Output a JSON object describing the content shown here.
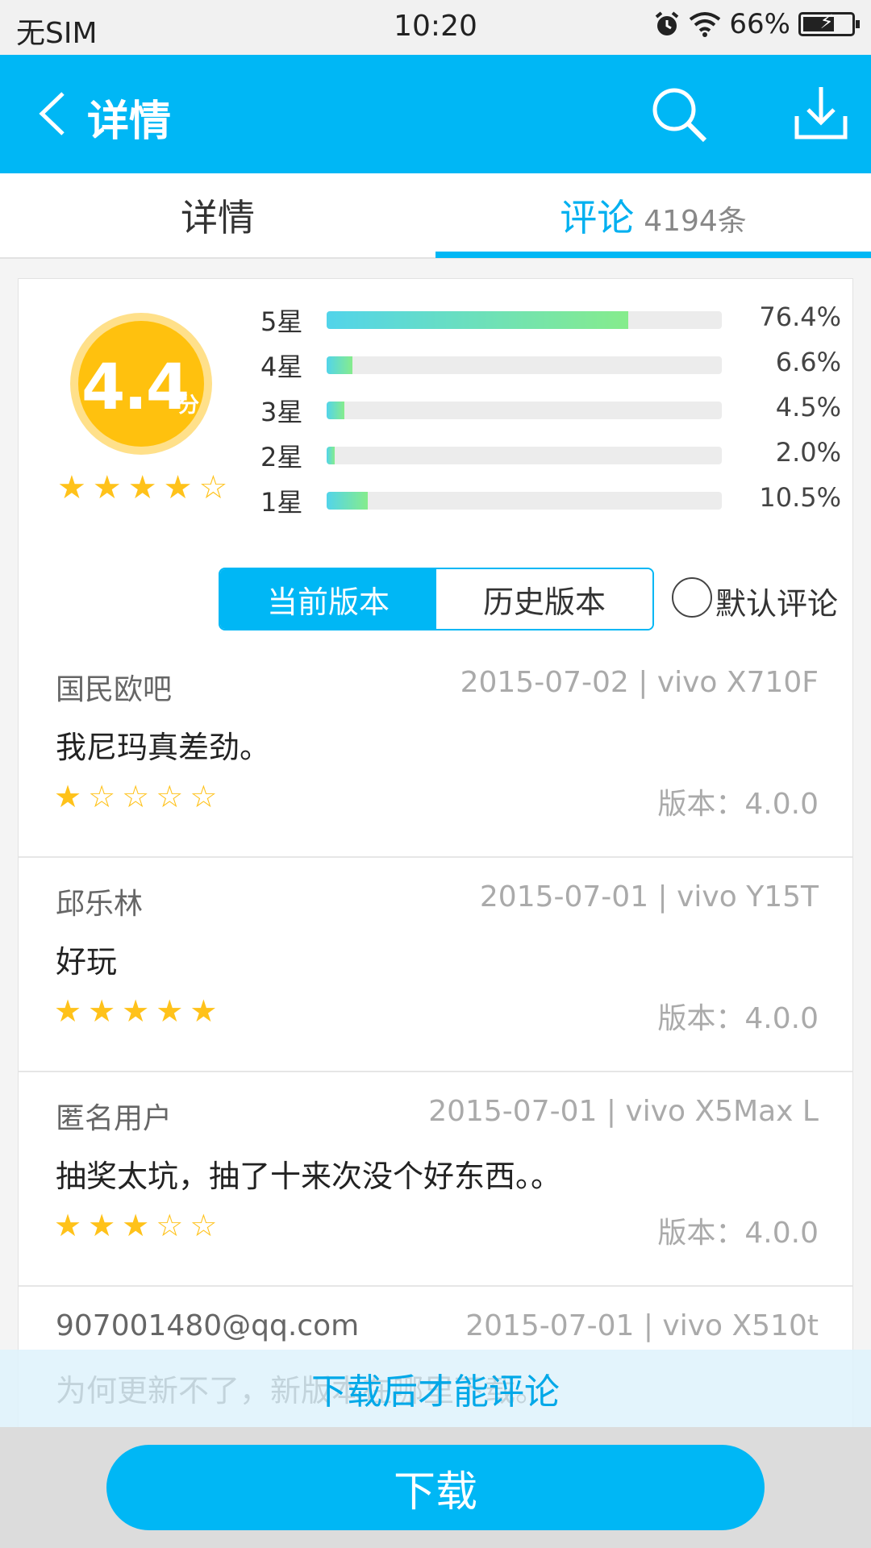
{
  "status_bar": {
    "carrier": "无SIM",
    "time": "10:20",
    "battery": "66%",
    "battery_level": 0.66
  },
  "header": {
    "title": "详情"
  },
  "tabs": {
    "details": "详情",
    "comments": "评论",
    "comments_count": "4194条"
  },
  "rating": {
    "score": "4.4",
    "unit": "分",
    "stars": 4,
    "distribution": [
      {
        "label": "5星",
        "percent": "76.4%",
        "value": 76.4
      },
      {
        "label": "4星",
        "percent": "6.6%",
        "value": 6.6
      },
      {
        "label": "3星",
        "percent": "4.5%",
        "value": 4.5
      },
      {
        "label": "2星",
        "percent": "2.0%",
        "value": 2.0
      },
      {
        "label": "1星",
        "percent": "10.5%",
        "value": 10.5
      }
    ]
  },
  "filters": {
    "current_version": "当前版本",
    "history_version": "历史版本",
    "default_sort": "默认评论"
  },
  "reviews": [
    {
      "user": "国民欧吧",
      "meta": "2015-07-02 | vivo X710F",
      "text": "我尼玛真差劲。",
      "stars": 1,
      "version": "版本：4.0.0"
    },
    {
      "user": "邱乐林",
      "meta": "2015-07-01 | vivo Y15T",
      "text": "好玩",
      "stars": 5,
      "version": "版本：4.0.0"
    },
    {
      "user": "匿名用户",
      "meta": "2015-07-01 | vivo X5Max L",
      "text": "抽奖太坑，抽了十来次没个好东西。。",
      "stars": 3,
      "version": "版本：4.0.0"
    },
    {
      "user": "907001480@qq.com",
      "meta": "2015-07-01 | vivo X510t",
      "text": "为何更新不了，新版本在哪里下载。",
      "stars": 0,
      "version": ""
    }
  ],
  "overlay": {
    "hint": "下载后才能评论"
  },
  "footer": {
    "download": "下载"
  },
  "colors": {
    "primary": "#00b7f5",
    "star": "#ffc21a",
    "badge": "#ffc10e"
  }
}
